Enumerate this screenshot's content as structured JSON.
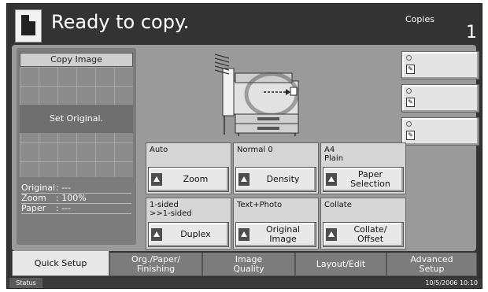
{
  "header": {
    "status_message": "Ready to copy.",
    "copies_label": "Copies",
    "copies_value": "1"
  },
  "copy_image": {
    "title": "Copy Image",
    "message": "Set Original.",
    "info": [
      {
        "key": "Original",
        "value": ":  ---"
      },
      {
        "key": "Zoom",
        "value": ": 100%"
      },
      {
        "key": "Paper",
        "value": ":  ---"
      }
    ]
  },
  "shortcuts": [
    {
      "icon": "shortcut-icon"
    },
    {
      "icon": "shortcut-icon"
    },
    {
      "icon": "shortcut-icon"
    }
  ],
  "settings": {
    "zoom": {
      "value": "Auto",
      "label": "Zoom"
    },
    "density": {
      "value": "Normal 0",
      "label": "Density"
    },
    "paper": {
      "value": "A4\nPlain",
      "label": "Paper\nSelection"
    },
    "duplex": {
      "value": "1-sided\n>>1-sided",
      "label": "Duplex"
    },
    "original_image": {
      "value": "Text+Photo",
      "label": "Original\nImage"
    },
    "collate": {
      "value": "Collate",
      "label": "Collate/\nOffset"
    }
  },
  "tabs": [
    {
      "label": "Quick Setup",
      "active": true
    },
    {
      "label": "Org./Paper/\nFinishing",
      "active": false
    },
    {
      "label": "Image\nQuality",
      "active": false
    },
    {
      "label": "Layout/Edit",
      "active": false
    },
    {
      "label": "Advanced\nSetup",
      "active": false
    }
  ],
  "statusbar": {
    "label": "Status",
    "datetime": "10/5/2006   10:10"
  },
  "colors": {
    "screen_bg": "#333333",
    "panel_bg": "#9a9a9a",
    "button_bg": "#e8e8e8"
  }
}
